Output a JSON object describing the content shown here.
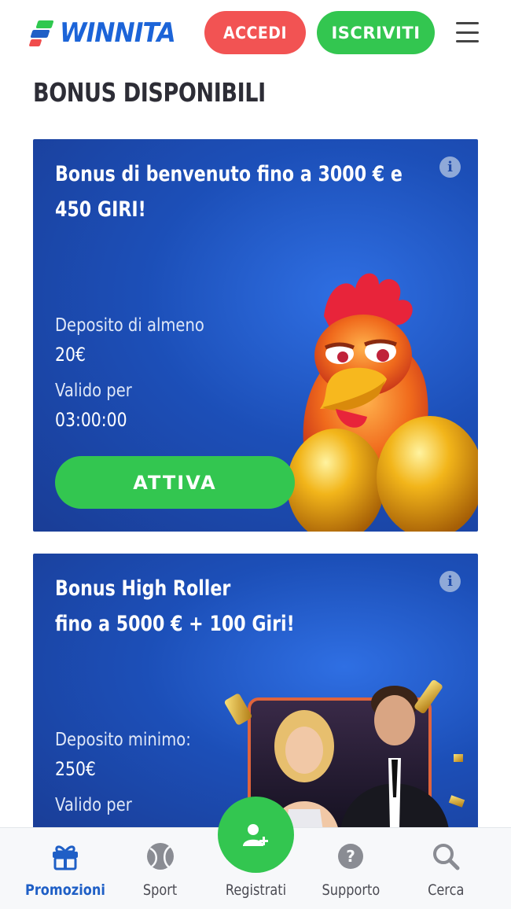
{
  "header": {
    "logo_text": "WINNITA",
    "login_label": "ACCEDI",
    "signup_label": "ISCRIVITI",
    "menu_icon": "hamburger-menu-icon"
  },
  "page": {
    "section_title": "BONUS DISPONIBILI"
  },
  "bonuses": [
    {
      "title_line1": "Bonus di benvenuto fino a 3000 € e",
      "title_line2": "450 GIRI!",
      "deposit_label": "Deposito di almeno",
      "deposit_value": "20€",
      "valid_label": "Valido per",
      "valid_value": "03:00:00",
      "cta_label": "ATTIVA",
      "art": "rooster-with-golden-eggs"
    },
    {
      "title_line1": "Bonus High Roller",
      "title_line2": "fino a 5000 € + 100 Giri!",
      "deposit_label": "Deposito minimo:",
      "deposit_value": "250€",
      "valid_label": "Valido per",
      "art": "couple-casino-confetti"
    }
  ],
  "bottom_nav": {
    "items": [
      {
        "label": "Promozioni",
        "icon": "gift-icon",
        "active": true
      },
      {
        "label": "Sport",
        "icon": "ball-icon",
        "active": false
      },
      {
        "label": "Registrati",
        "icon": "add-user-icon",
        "active": false
      },
      {
        "label": "Supporto",
        "icon": "help-icon",
        "active": false
      },
      {
        "label": "Cerca",
        "icon": "search-icon",
        "active": false
      }
    ]
  },
  "colors": {
    "brand_blue": "#1c64d8",
    "login_red": "#f25353",
    "signup_green": "#33c650",
    "card_blue": "#1c4fb8",
    "active_nav": "#1f5fc6"
  }
}
